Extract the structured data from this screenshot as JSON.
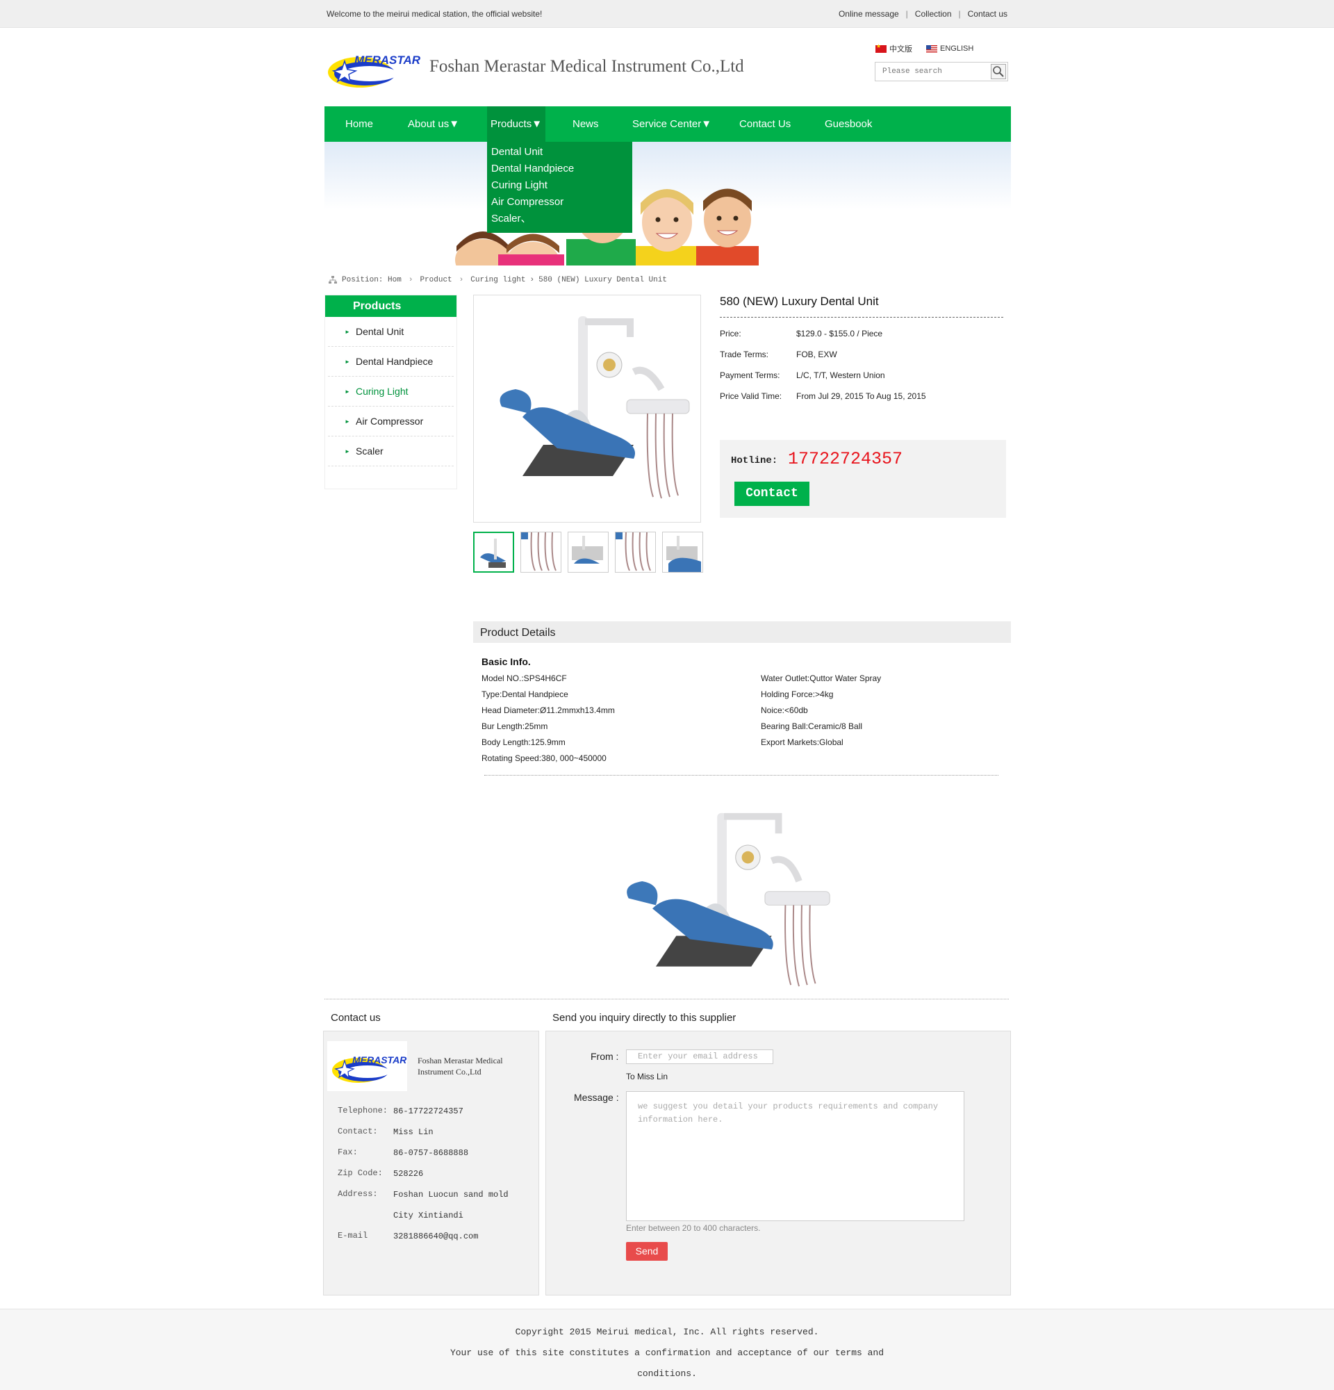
{
  "topbar": {
    "welcome": "Welcome to the meirui medical station, the official website!",
    "links": [
      "Online message",
      "Collection",
      "Contact us"
    ]
  },
  "header": {
    "logo_text": "MERASTAR",
    "company": "Foshan Merastar Medical Instrument Co.,Ltd",
    "lang_cn": "中文版",
    "lang_en": "ENGLISH",
    "search_placeholder": "Please search"
  },
  "nav": {
    "items": [
      "Home",
      "About us▼",
      "Products▼",
      "News",
      "Service Center▼",
      "Contact Us",
      "Guesbook"
    ],
    "active": "Products▼",
    "dropdown": [
      "Dental Unit",
      "Dental Handpiece",
      "Curing Light",
      "Air Compressor",
      "Scaler、"
    ]
  },
  "breadcrumb": [
    "Position: Hom",
    "Product",
    "Curing light",
    "580 (NEW) Luxury Dental Unit"
  ],
  "sidebar": {
    "title": "Products",
    "items": [
      "Dental Unit",
      "Dental Handpiece",
      "Curing Light",
      "Air Compressor",
      "Scaler"
    ],
    "active_index": 2
  },
  "product": {
    "title": "580 (NEW) Luxury Dental Unit",
    "specs": [
      {
        "k": "Price:",
        "v": "$129.0 - $155.0 / Piece"
      },
      {
        "k": "Trade Terms:",
        "v": "FOB, EXW"
      },
      {
        "k": "Payment Terms:",
        "v": "L/C, T/T, Western Union"
      },
      {
        "k": "Price Valid Time:",
        "v": "From Jul 29, 2015 To Aug 15, 2015"
      }
    ],
    "hotline_label": "Hotline:",
    "hotline": "17722724357",
    "contact_btn": "Contact",
    "thumb_count": 5
  },
  "details": {
    "heading": "Product Details",
    "basic": "Basic Info.",
    "left": [
      "Model NO.:SPS4H6CF",
      "Type:Dental Handpiece",
      "Head Diameter:Ø11.2mmxh13.4mm",
      "Bur Length:25mm",
      "Body Length:125.9mm",
      "Rotating Speed:380, 000~450000"
    ],
    "right": [
      "Water Outlet:Quttor Water Spray",
      "Holding Force:>4kg",
      "Noice:<60db",
      "Bearing Ball:Ceramic/8 Ball",
      "Export Markets:Global"
    ]
  },
  "contact": {
    "title": "Contact us",
    "company": "Foshan Merastar Medical Instrument Co.,Ltd",
    "rows": [
      {
        "k": "Telephone:",
        "v": "86-17722724357"
      },
      {
        "k": "Contact:",
        "v": "Miss Lin"
      },
      {
        "k": "Fax:",
        "v": "86-0757-8688888"
      },
      {
        "k": "Zip Code:",
        "v": "528226"
      },
      {
        "k": "Address:",
        "v": "Foshan Luocun sand mold City Xintiandi"
      },
      {
        "k": "E-mail",
        "v": "3281886640@qq.com"
      }
    ]
  },
  "inquiry": {
    "title": "Send you inquiry directly to this supplier",
    "from_label": "From :",
    "from_placeholder": "Enter your email address",
    "to": "To Miss Lin",
    "message_label": "Message :",
    "message_placeholder": "we suggest you detail your products requirements and company information here.",
    "hint": "Enter between 20 to 400 characters.",
    "send": "Send"
  },
  "footer": {
    "line1": "Copyright 2015 Meirui medical, Inc. All rights reserved.",
    "line2": "Your use of this site constitutes a confirmation and acceptance of our terms and",
    "line3": "conditions."
  },
  "colors": {
    "brand_green": "#00b14b",
    "dark_green": "#00923c",
    "hotline_red": "#e8141c",
    "send_red": "#e84b4b"
  }
}
